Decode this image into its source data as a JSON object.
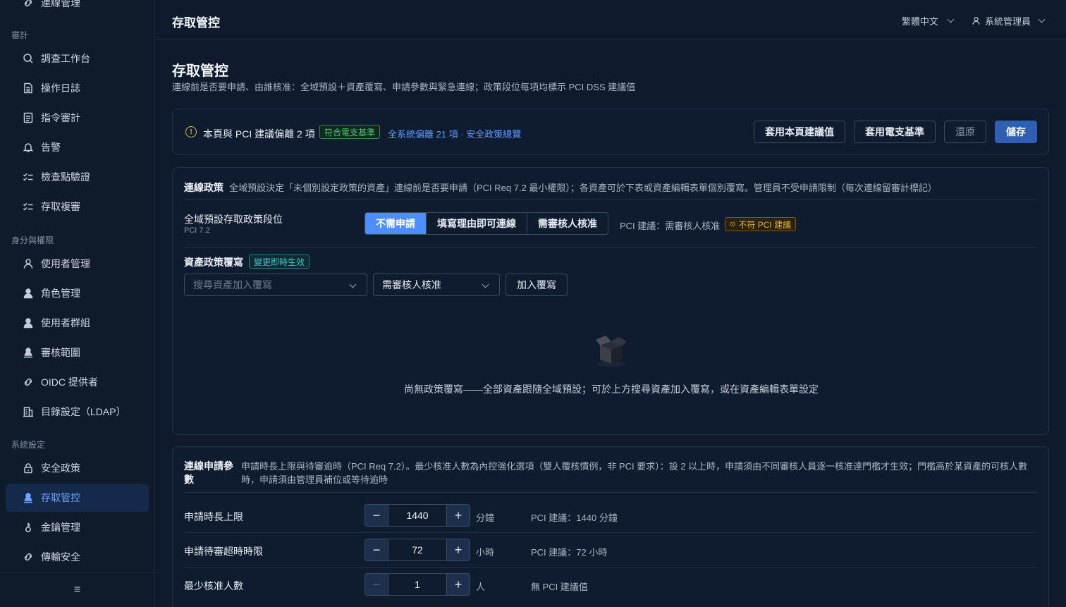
{
  "sidebar": {
    "top_partial": "連線管理",
    "sections": [
      "審計",
      "身分與權限",
      "系統設定"
    ],
    "items": [
      {
        "label": "調查工作台",
        "icon": "search-icon"
      },
      {
        "label": "操作日誌",
        "icon": "document-icon"
      },
      {
        "label": "指令審計",
        "icon": "list-icon"
      },
      {
        "label": "告警",
        "icon": "bell-icon"
      },
      {
        "label": "檢查點驗證",
        "icon": "check-list-icon"
      },
      {
        "label": "存取複審",
        "icon": "check-list-icon"
      },
      {
        "label": "使用者管理",
        "icon": "user-icon"
      },
      {
        "label": "角色管理",
        "icon": "user-filled-icon"
      },
      {
        "label": "使用者群組",
        "icon": "user-group-icon"
      },
      {
        "label": "審核範圍",
        "icon": "user-scope-icon"
      },
      {
        "label": "OIDC 提供者",
        "icon": "link-icon"
      },
      {
        "label": "目錄設定（LDAP）",
        "icon": "building-icon"
      },
      {
        "label": "安全政策",
        "icon": "lock-icon"
      },
      {
        "label": "存取管控",
        "icon": "user-key-icon"
      },
      {
        "label": "金鑰管理",
        "icon": "key-icon"
      },
      {
        "label": "傳輸安全",
        "icon": "link-icon"
      }
    ],
    "active_index": 13,
    "footer_icon": "menu-icon"
  },
  "header": {
    "title": "存取管控",
    "language": "繁體中文",
    "user": "系統管理員"
  },
  "page": {
    "title": "存取管控",
    "subtitle": "連線前是否要申請、由誰核准：全域預設＋資產覆寫、申請參數與緊急連線；政策段位每項均標示 PCI DSS 建議值"
  },
  "notice": {
    "text": "本頁與 PCI 建議偏離 2 項",
    "tag": "符合電支基準",
    "link": "全系統偏離 21 項 · 安全政策總覽",
    "buttons": {
      "apply_page": "套用本頁建議值",
      "apply_baseline": "套用電支基準",
      "revert": "還原",
      "save": "儲存"
    }
  },
  "policy": {
    "title": "連線政策",
    "desc": "全域預設決定「未個別設定政策的資產」連線前是否要申請（PCI Req 7.2 最小權限）；各資產可於下表或資產編輯表單個別覆寫。管理員不受申請限制（每次連線留審計標記）",
    "global_label": "全域預設存取政策段位",
    "global_sub": "PCI 7.2",
    "options": [
      "不需申請",
      "填寫理由即可連線",
      "需審核人核准"
    ],
    "selected": 0,
    "pci_note": "PCI 建議：需審核人核准",
    "pci_tag": "不符 PCI 建議",
    "override_label": "資產政策覆寫",
    "override_tag": "變更即時生效",
    "asset_placeholder": "搜尋資產加入覆寫",
    "override_value": "需審核人核准",
    "add_button": "加入覆寫",
    "empty_text": "尚無政策覆寫——全部資產跟隨全域預設；可於上方搜尋資產加入覆寫，或在資產編輯表單設定"
  },
  "params": {
    "title": "連線申請參數",
    "desc": "申請時長上限與待審逾時（PCI Req 7.2）。最少核准人數為內控強化選項（雙人覆核慣例，非 PCI 要求）：設 2 以上時，申請須由不同審核人員逐一核准達門檻才生效；門檻高於某資產的可核人數時，申請須由管理員補位或等待逾時",
    "rows": [
      {
        "label": "申請時長上限",
        "value": "1440",
        "unit": "分鐘",
        "note": "PCI 建議：1440 分鐘"
      },
      {
        "label": "申請待審超時時限",
        "value": "72",
        "unit": "小時",
        "note": "PCI 建議：72 小時"
      },
      {
        "label": "最少核准人數",
        "value": "1",
        "unit": "人",
        "note": "無 PCI 建議值"
      }
    ],
    "minus": "−",
    "plus": "+"
  },
  "colors": {
    "accent": "#4d8dff",
    "primary_button": "#2f5fb3",
    "warning": "#e6b23c",
    "success": "#4fc472",
    "info": "#3ec6d4"
  }
}
